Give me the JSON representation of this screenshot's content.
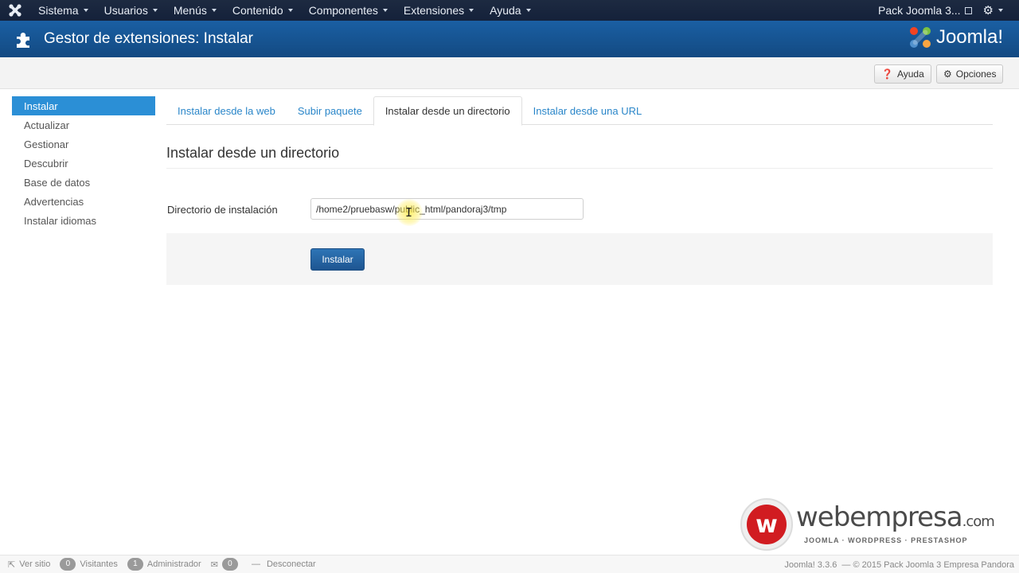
{
  "navbar": {
    "menu": [
      "Sistema",
      "Usuarios",
      "Menús",
      "Contenido",
      "Componentes",
      "Extensiones",
      "Ayuda"
    ],
    "site_link": "Pack Joomla 3..."
  },
  "header": {
    "title": "Gestor de extensiones: Instalar",
    "logo_text": "Joomla!"
  },
  "toolbar": {
    "help_label": "Ayuda",
    "options_label": "Opciones"
  },
  "sidebar": {
    "items": [
      "Instalar",
      "Actualizar",
      "Gestionar",
      "Descubrir",
      "Base de datos",
      "Advertencias",
      "Instalar idiomas"
    ]
  },
  "tabs": [
    "Instalar desde la web",
    "Subir paquete",
    "Instalar desde un directorio",
    "Instalar desde una URL"
  ],
  "form": {
    "title": "Instalar desde un directorio",
    "dir_label": "Directorio de instalación",
    "dir_value": "/home2/pruebasw/public_html/pandoraj3/tmp",
    "install_button": "Instalar"
  },
  "watermark": {
    "brand": "webempresa",
    "tld": ".com",
    "tagline": "JOOMLA · WORDPRESS · PRESTASHOP"
  },
  "statusbar": {
    "view_site": "Ver sitio",
    "visitors_count": "0",
    "visitors_label": "Visitantes",
    "admin_count": "1",
    "admin_label": "Administrador",
    "messages_count": "0",
    "logout_label": "Desconectar",
    "version": "Joomla! 3.3.6",
    "copyright": "— © 2015 Pack Joomla 3 Empresa Pandora"
  },
  "colors": {
    "navbar": "#17233b",
    "header": "#1a5fa3",
    "sidebar_active": "#2b8fd6",
    "link": "#2a86c9",
    "primary_button": "#2565a6",
    "brand_red": "#d11c21"
  }
}
